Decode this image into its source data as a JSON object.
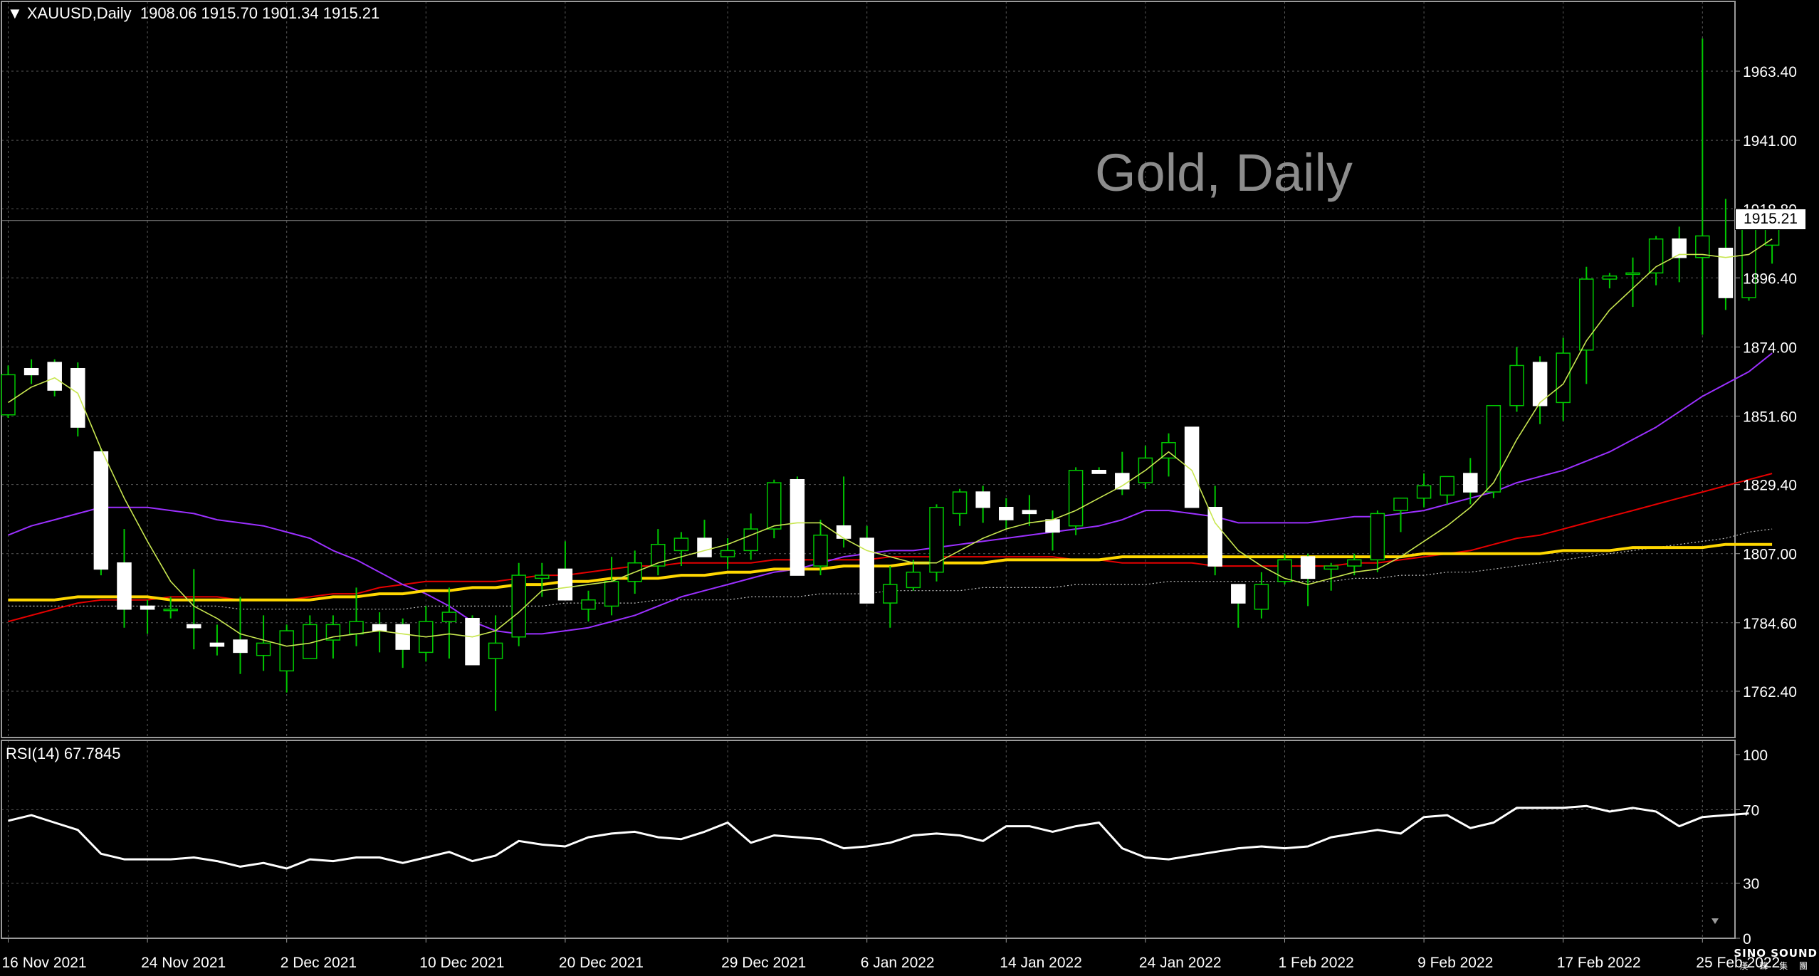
{
  "header": {
    "symbol": "XAUUSD,Daily",
    "ohlc": "1908.06 1915.70 1901.34 1915.21",
    "collapse_icon": "triangle-down-icon"
  },
  "watermark": "Gold, Daily",
  "current_price_label": "1915.21",
  "rsi_header": "RSI(14) 67.7845",
  "logo": {
    "line1": "SINO SOUND",
    "line2": "漢 聲 集 團"
  },
  "colors": {
    "background": "#000000",
    "grid": "#5a5a5a",
    "bull_candle": "#00c800",
    "bear_candle": "#ffffff",
    "ma_fast": "#c8e650",
    "ma_purple": "#9b30ff",
    "ma_red": "#e60000",
    "ma_yellow": "#ffd700",
    "ma_dotted": "#bfbfbf",
    "rsi_line": "#ffffff"
  },
  "chart_data": [
    {
      "type": "candlestick",
      "symbol": "XAUUSD",
      "timeframe": "Daily",
      "ylim": [
        1750,
        1982
      ],
      "y_ticks": [
        1762.4,
        1784.6,
        1807.0,
        1829.4,
        1851.6,
        1874.0,
        1896.4,
        1918.8,
        1941.0,
        1963.4
      ],
      "x_tick_labels": [
        "16 Nov 2021",
        "24 Nov 2021",
        "2 Dec 2021",
        "10 Dec 2021",
        "20 Dec 2021",
        "29 Dec 2021",
        "6 Jan 2022",
        "14 Jan 2022",
        "24 Jan 2022",
        "1 Feb 2022",
        "9 Feb 2022",
        "17 Feb 2022",
        "25 Feb 2022"
      ],
      "x_tick_index": [
        0,
        6,
        12,
        18,
        24,
        31,
        37,
        43,
        49,
        55,
        61,
        67,
        73
      ],
      "grid": true,
      "candles": [
        [
          1852,
          1868,
          1851,
          1865
        ],
        [
          1867,
          1870,
          1862,
          1865
        ],
        [
          1869,
          1870,
          1858,
          1860
        ],
        [
          1867,
          1869,
          1845,
          1848
        ],
        [
          1840,
          1841,
          1800,
          1802
        ],
        [
          1804,
          1815,
          1783,
          1789
        ],
        [
          1790,
          1792,
          1781,
          1789
        ],
        [
          1789,
          1793,
          1786,
          1789
        ],
        [
          1784,
          1802,
          1776,
          1783
        ],
        [
          1778,
          1784,
          1774,
          1777
        ],
        [
          1779,
          1793,
          1768,
          1775
        ],
        [
          1774,
          1787,
          1769,
          1778
        ],
        [
          1769,
          1784,
          1762,
          1782
        ],
        [
          1773,
          1787,
          1773,
          1784
        ],
        [
          1779,
          1787,
          1773,
          1784
        ],
        [
          1781,
          1796,
          1777,
          1785
        ],
        [
          1784,
          1788,
          1775,
          1782
        ],
        [
          1784,
          1786,
          1770,
          1776
        ],
        [
          1775,
          1790,
          1772,
          1785
        ],
        [
          1785,
          1796,
          1773,
          1788
        ],
        [
          1786,
          1787,
          1771,
          1771
        ],
        [
          1773,
          1787,
          1756,
          1778
        ],
        [
          1780,
          1804,
          1777,
          1800
        ],
        [
          1799,
          1804,
          1793,
          1800
        ],
        [
          1802,
          1811,
          1794,
          1792
        ],
        [
          1789,
          1795,
          1785,
          1792
        ],
        [
          1790,
          1806,
          1787,
          1798
        ],
        [
          1798,
          1808,
          1794,
          1804
        ],
        [
          1803,
          1815,
          1800,
          1810
        ],
        [
          1808,
          1814,
          1803,
          1812
        ],
        [
          1812,
          1818,
          1808,
          1806
        ],
        [
          1806,
          1812,
          1802,
          1808
        ],
        [
          1808,
          1820,
          1805,
          1815
        ],
        [
          1815,
          1831,
          1812,
          1830
        ],
        [
          1831,
          1832,
          1800,
          1800
        ],
        [
          1803,
          1818,
          1800,
          1813
        ],
        [
          1816,
          1832,
          1809,
          1812
        ],
        [
          1812,
          1816,
          1792,
          1791
        ],
        [
          1791,
          1803,
          1783,
          1797
        ],
        [
          1796,
          1805,
          1795,
          1801
        ],
        [
          1801,
          1823,
          1798,
          1822
        ],
        [
          1820,
          1828,
          1816,
          1827
        ],
        [
          1827,
          1829,
          1817,
          1822
        ],
        [
          1822,
          1825,
          1815,
          1818
        ],
        [
          1821,
          1826,
          1816,
          1820
        ],
        [
          1818,
          1821,
          1808,
          1814
        ],
        [
          1816,
          1835,
          1813,
          1834
        ],
        [
          1834,
          1835,
          1833,
          1833
        ],
        [
          1833,
          1840,
          1826,
          1828
        ],
        [
          1830,
          1842,
          1828,
          1838
        ],
        [
          1838,
          1846,
          1832,
          1843
        ],
        [
          1848,
          1848,
          1830,
          1822
        ],
        [
          1822,
          1829,
          1800,
          1803
        ],
        [
          1797,
          1797,
          1783,
          1791
        ],
        [
          1789,
          1801,
          1786,
          1797
        ],
        [
          1798,
          1807,
          1797,
          1805
        ],
        [
          1806,
          1807,
          1790,
          1799
        ],
        [
          1802,
          1804,
          1795,
          1803
        ],
        [
          1803,
          1807,
          1800,
          1805
        ],
        [
          1805,
          1821,
          1801,
          1820
        ],
        [
          1821,
          1825,
          1814,
          1825
        ],
        [
          1825,
          1833,
          1822,
          1829
        ],
        [
          1826,
          1832,
          1823,
          1832
        ],
        [
          1833,
          1838,
          1823,
          1827
        ],
        [
          1827,
          1855,
          1825,
          1855
        ],
        [
          1855,
          1874,
          1853,
          1868
        ],
        [
          1869,
          1871,
          1849,
          1855
        ],
        [
          1856,
          1877,
          1850,
          1872
        ],
        [
          1873,
          1900,
          1862,
          1896
        ],
        [
          1896,
          1898,
          1893,
          1897
        ],
        [
          1898,
          1903,
          1887,
          1898
        ],
        [
          1898,
          1910,
          1894,
          1909
        ],
        [
          1909,
          1913,
          1895,
          1903
        ],
        [
          1903,
          1974,
          1878,
          1910
        ],
        [
          1906,
          1922,
          1886,
          1890
        ],
        [
          1890,
          1911,
          1889,
          1918
        ],
        [
          1907,
          1916,
          1901,
          1915
        ]
      ],
      "ma_fast": [
        1856,
        1861,
        1864,
        1859,
        1841,
        1825,
        1811,
        1798,
        1790,
        1786,
        1781,
        1779,
        1777,
        1778,
        1780,
        1781,
        1782,
        1781,
        1780,
        1781,
        1780,
        1782,
        1788,
        1795,
        1796,
        1797,
        1798,
        1801,
        1804,
        1806,
        1808,
        1810,
        1813,
        1816,
        1817,
        1817,
        1812,
        1808,
        1806,
        1804,
        1804,
        1808,
        1812,
        1815,
        1817,
        1818,
        1821,
        1825,
        1829,
        1834,
        1840,
        1834,
        1817,
        1808,
        1803,
        1799,
        1797,
        1799,
        1801,
        1802,
        1806,
        1811,
        1816,
        1822,
        1830,
        1844,
        1856,
        1862,
        1876,
        1886,
        1893,
        1900,
        1904,
        1904,
        1903,
        1904,
        1909
      ],
      "ma_purple": [
        1813,
        1816,
        1818,
        1820,
        1822,
        1822,
        1822,
        1821,
        1820,
        1818,
        1817,
        1816,
        1814,
        1812,
        1808,
        1805,
        1801,
        1797,
        1794,
        1790,
        1785,
        1782,
        1781,
        1781,
        1782,
        1783,
        1785,
        1787,
        1790,
        1793,
        1795,
        1797,
        1799,
        1801,
        1802,
        1804,
        1806,
        1807,
        1808,
        1808,
        1809,
        1810,
        1811,
        1812,
        1813,
        1814,
        1815,
        1816,
        1818,
        1821,
        1821,
        1820,
        1819,
        1817,
        1817,
        1817,
        1817,
        1818,
        1819,
        1819,
        1820,
        1821,
        1823,
        1825,
        1827,
        1830,
        1832,
        1834,
        1837,
        1840,
        1844,
        1848,
        1853,
        1858,
        1862,
        1866,
        1872
      ],
      "ma_red": [
        1785,
        1787,
        1789,
        1791,
        1792,
        1792,
        1792,
        1793,
        1793,
        1793,
        1792,
        1792,
        1792,
        1793,
        1794,
        1794,
        1796,
        1797,
        1798,
        1798,
        1798,
        1798,
        1799,
        1800,
        1800,
        1801,
        1802,
        1803,
        1803,
        1804,
        1804,
        1804,
        1804,
        1805,
        1805,
        1805,
        1805,
        1805,
        1806,
        1806,
        1806,
        1806,
        1806,
        1806,
        1806,
        1806,
        1805,
        1805,
        1804,
        1804,
        1804,
        1804,
        1803,
        1803,
        1803,
        1803,
        1803,
        1803,
        1804,
        1804,
        1805,
        1806,
        1807,
        1808,
        1810,
        1812,
        1813,
        1815,
        1817,
        1819,
        1821,
        1823,
        1825,
        1827,
        1829,
        1831,
        1833
      ],
      "ma_yellow": [
        1792,
        1792,
        1792,
        1793,
        1793,
        1793,
        1793,
        1792,
        1792,
        1792,
        1792,
        1792,
        1792,
        1792,
        1793,
        1793,
        1794,
        1794,
        1795,
        1795,
        1796,
        1796,
        1797,
        1797,
        1798,
        1798,
        1799,
        1799,
        1799,
        1800,
        1800,
        1801,
        1801,
        1802,
        1802,
        1802,
        1803,
        1803,
        1803,
        1804,
        1804,
        1804,
        1804,
        1805,
        1805,
        1805,
        1805,
        1805,
        1806,
        1806,
        1806,
        1806,
        1806,
        1806,
        1806,
        1806,
        1806,
        1806,
        1806,
        1806,
        1806,
        1807,
        1807,
        1807,
        1807,
        1807,
        1807,
        1808,
        1808,
        1808,
        1809,
        1809,
        1809,
        1809,
        1810,
        1810,
        1810
      ],
      "ma_dotted": [
        1790,
        1790,
        1790,
        1790,
        1790,
        1790,
        1790,
        1790,
        1790,
        1790,
        1789,
        1789,
        1789,
        1789,
        1789,
        1789,
        1789,
        1789,
        1790,
        1790,
        1790,
        1790,
        1790,
        1790,
        1791,
        1791,
        1791,
        1791,
        1792,
        1792,
        1792,
        1792,
        1793,
        1793,
        1793,
        1794,
        1794,
        1794,
        1795,
        1795,
        1795,
        1795,
        1796,
        1796,
        1796,
        1796,
        1797,
        1797,
        1797,
        1797,
        1798,
        1798,
        1798,
        1798,
        1798,
        1798,
        1798,
        1798,
        1799,
        1799,
        1800,
        1800,
        1801,
        1801,
        1802,
        1803,
        1804,
        1805,
        1806,
        1807,
        1808,
        1809,
        1810,
        1811,
        1812,
        1814,
        1815
      ]
    },
    {
      "type": "line",
      "name": "RSI(14) 67.7845",
      "ylim": [
        0,
        100
      ],
      "y_ticks": [
        0,
        30,
        70,
        100
      ],
      "values": [
        64,
        67,
        63,
        59,
        46,
        43,
        43,
        43,
        44,
        42,
        39,
        41,
        38,
        43,
        42,
        44,
        44,
        41,
        44,
        47,
        42,
        45,
        53,
        51,
        50,
        55,
        57,
        58,
        55,
        54,
        58,
        63,
        52,
        56,
        55,
        54,
        49,
        50,
        52,
        56,
        57,
        56,
        53,
        61,
        61,
        58,
        61,
        63,
        49,
        44,
        43,
        45,
        47,
        49,
        50,
        49,
        50,
        55,
        57,
        59,
        57,
        66,
        67,
        60,
        63,
        71,
        71,
        71,
        72,
        69,
        71,
        69,
        61,
        66,
        67,
        68
      ]
    }
  ]
}
